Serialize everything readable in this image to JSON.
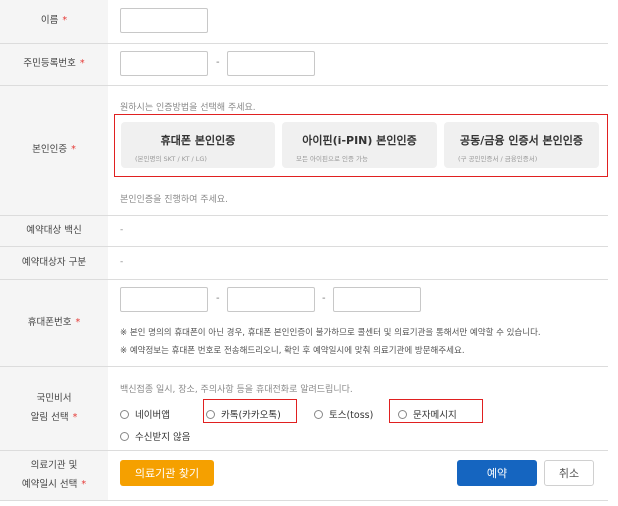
{
  "name": {
    "label": "이름",
    "required_mark": "*"
  },
  "resident_number": {
    "label": "주민등록번호",
    "required_mark": "*",
    "separator": "-"
  },
  "identity": {
    "label": "본인인증",
    "required_mark": "*",
    "guide": "원하시는 인증방법을 선택해 주세요.",
    "options": [
      {
        "title": "휴대폰 본인인증",
        "subtitle": "(본인명의 SKT / KT / LG)"
      },
      {
        "title": "아이핀(i-PIN) 본인인증",
        "subtitle": "모든 아이핀으로 인증 가능"
      },
      {
        "title": "공동/금융 인증서 본인인증",
        "subtitle": "(구 공인인증서 / 금융인증서)"
      }
    ],
    "status": "본인인증을 진행하여 주세요."
  },
  "vaccine": {
    "label": "예약대상 백신",
    "value": "-"
  },
  "target_type": {
    "label": "예약대상자 구분",
    "value": "-"
  },
  "phone": {
    "label": "휴대폰번호",
    "required_mark": "*",
    "separator": "-",
    "notes": [
      "※ 본인 명의의 휴대폰이 아닌 경우, 휴대폰 본인인증이 불가하므로 콜센터 및 의료기관을 통해서만 예약할 수 있습니다.",
      "※ 예약정보는 휴대폰 번호로 전송해드리오니, 확인 후 예약일시에 맞춰 의료기관에 방문해주세요."
    ]
  },
  "notify": {
    "label_line1": "국민비서",
    "label_line2": "알림 선택",
    "required_mark": "*",
    "guide": "백신접종 일시, 장소, 주의사항 등을 휴대전화로 알려드립니다.",
    "options": [
      "네이버앱",
      "카톡(카카오톡)",
      "토스(toss)",
      "문자메시지",
      "수신받지 않음"
    ]
  },
  "hospital": {
    "label_line1": "의료기관 및",
    "label_line2": "예약일시 선택",
    "required_mark": "*",
    "find_button": "의료기관 찾기",
    "reserve_button": "예약",
    "cancel_button": "취소"
  },
  "colors": {
    "required": "#e53935",
    "highlight": "#e02020",
    "orange": "#f5a000",
    "blue": "#1565c0",
    "label_bg": "#f5f5f5"
  }
}
